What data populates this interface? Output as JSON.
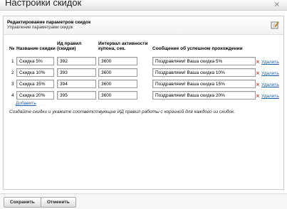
{
  "window": {
    "title": "Настройки скидок"
  },
  "panel": {
    "title": "Редактирование параметров скидок",
    "subtitle": "Управление параметрами скидок"
  },
  "table": {
    "headers": {
      "num": "№",
      "name": "Название скидки",
      "rule_id": "Ид правил (скидки)",
      "interval": "Интервал активности купона, сек.",
      "message": "Сообщение об успешном прохождении"
    },
    "rows": [
      {
        "num": "1",
        "name": "Скидка 5%",
        "rule_id": "392",
        "interval": "3600",
        "message": "Поздравляем! Ваша скидка 5%",
        "delete_label": "Удалить"
      },
      {
        "num": "2",
        "name": "Скидка 10%",
        "rule_id": "393",
        "interval": "3600",
        "message": "Поздравляем! Ваша скидка 10%",
        "delete_label": "Удалить"
      },
      {
        "num": "3",
        "name": "Скидка 15%",
        "rule_id": "394",
        "interval": "3600",
        "message": "Поздравляем! Ваша скидка 15%",
        "delete_label": "Удалить"
      },
      {
        "num": "4",
        "name": "Скидка 20%",
        "rule_id": "395",
        "interval": "3600",
        "message": "Поздравляем! Ваша скидка 20%",
        "delete_label": "Удалить"
      }
    ]
  },
  "add_label": "Добавить",
  "hint": "Создайте скидки и укажите соответствующие ИД правил работы с корзиной для каждого из скидок.",
  "footer": {
    "save_label": "Сохранить",
    "cancel_label": "Отменить"
  },
  "colors": {
    "link": "#1c5fa8",
    "delete_x": "#c0392b"
  },
  "icons": {
    "close": "close-icon",
    "edit": "edit-icon",
    "delete": "delete-x-icon"
  }
}
